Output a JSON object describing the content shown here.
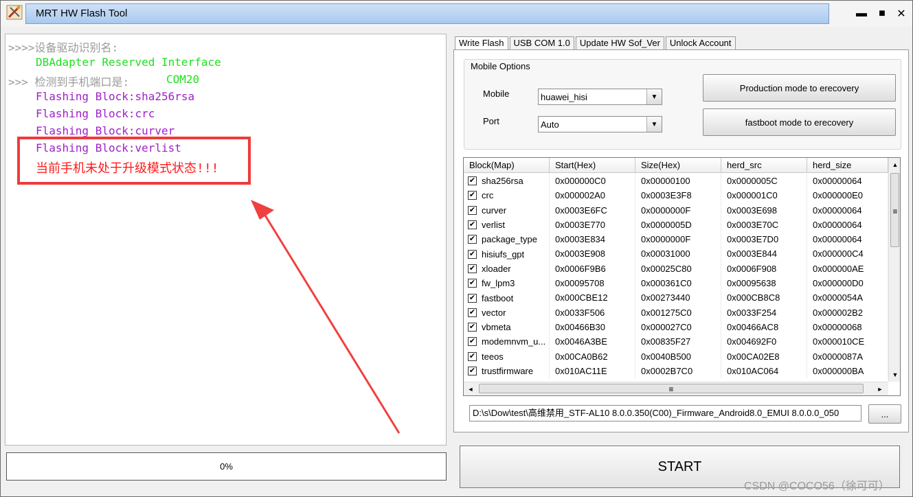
{
  "window": {
    "title": "MRT HW Flash Tool",
    "minimize_label": "▬",
    "maximize_label": "■",
    "close_label": "✕"
  },
  "log": {
    "lines": [
      {
        "text": ">>>>设备驱动识别名:",
        "color": "#9a9a9a"
      },
      {
        "text": "DBAdapter Reserved Interface",
        "color": "#20e020"
      },
      {
        "text": ">>> 检测到手机端口是:",
        "color": "#9a9a9a"
      },
      {
        "text": "COM20",
        "color": "#20e020"
      },
      {
        "text": "Flashing Block:sha256rsa",
        "color": "#a020c8"
      },
      {
        "text": "Flashing Block:crc",
        "color": "#a020c8"
      },
      {
        "text": "Flashing Block:curver",
        "color": "#a020c8"
      },
      {
        "text": "Flashing Block:verlist",
        "color": "#a020c8"
      },
      {
        "text": "当前手机未处于升级模式状态!!!",
        "color": "#ff1a1a"
      }
    ]
  },
  "progress": {
    "label": "0%",
    "value": 0
  },
  "tabs": [
    {
      "label": "Write Flash",
      "active": true
    },
    {
      "label": "USB COM 1.0",
      "active": false
    },
    {
      "label": "Update HW Sof_Ver",
      "active": false
    },
    {
      "label": "Unlock Account",
      "active": false
    }
  ],
  "mobile_options": {
    "title": "Mobile Options",
    "mobile_label": "Mobile",
    "mobile_value": "huawei_hisi",
    "port_label": "Port",
    "port_value": "Auto",
    "production_button": "Production mode to erecovery",
    "fastboot_button": "fastboot mode to erecovery"
  },
  "grid": {
    "columns": [
      "Block(Map)",
      "Start(Hex)",
      "Size(Hex)",
      "herd_src",
      "herd_size"
    ],
    "rows": [
      {
        "checked": true,
        "cells": [
          "sha256rsa",
          "0x000000C0",
          "0x00000100",
          "0x0000005C",
          "0x00000064"
        ]
      },
      {
        "checked": true,
        "cells": [
          "crc",
          "0x000002A0",
          "0x0003E3F8",
          "0x000001C0",
          "0x000000E0"
        ]
      },
      {
        "checked": true,
        "cells": [
          "curver",
          "0x0003E6FC",
          "0x0000000F",
          "0x0003E698",
          "0x00000064"
        ]
      },
      {
        "checked": true,
        "cells": [
          "verlist",
          "0x0003E770",
          "0x0000005D",
          "0x0003E70C",
          "0x00000064"
        ]
      },
      {
        "checked": true,
        "cells": [
          "package_type",
          "0x0003E834",
          "0x0000000F",
          "0x0003E7D0",
          "0x00000064"
        ]
      },
      {
        "checked": true,
        "cells": [
          "hisiufs_gpt",
          "0x0003E908",
          "0x00031000",
          "0x0003E844",
          "0x000000C4"
        ]
      },
      {
        "checked": true,
        "cells": [
          "xloader",
          "0x0006F9B6",
          "0x00025C80",
          "0x0006F908",
          "0x000000AE"
        ]
      },
      {
        "checked": true,
        "cells": [
          "fw_lpm3",
          "0x00095708",
          "0x000361C0",
          "0x00095638",
          "0x000000D0"
        ]
      },
      {
        "checked": true,
        "cells": [
          "fastboot",
          "0x000CBE12",
          "0x00273440",
          "0x000CB8C8",
          "0x0000054A"
        ]
      },
      {
        "checked": true,
        "cells": [
          "vector",
          "0x0033F506",
          "0x001275C0",
          "0x0033F254",
          "0x000002B2"
        ]
      },
      {
        "checked": true,
        "cells": [
          "vbmeta",
          "0x00466B30",
          "0x000027C0",
          "0x00466AC8",
          "0x00000068"
        ]
      },
      {
        "checked": true,
        "cells": [
          "modemnvm_u...",
          "0x0046A3BE",
          "0x00835F27",
          "0x004692F0",
          "0x000010CE"
        ]
      },
      {
        "checked": true,
        "cells": [
          "teeos",
          "0x00CA0B62",
          "0x0040B500",
          "0x00CA02E8",
          "0x0000087A"
        ]
      },
      {
        "checked": true,
        "cells": [
          "trustfirmware",
          "0x010AC11E",
          "0x0002B7C0",
          "0x010AC064",
          "0x000000BA"
        ]
      }
    ],
    "scroll_up": "▲",
    "scroll_down": "▼",
    "scroll_left": "◄",
    "scroll_right": "►",
    "scroll_grip": "≡"
  },
  "firmware_path": "D:\\s\\Dow\\test\\高维禁用_STF-AL10 8.0.0.350(C00)_Firmware_Android8.0_EMUI 8.0.0.0_050",
  "browse_button": "...",
  "start_button": "START",
  "watermark": "CSDN @COCO56（徐可可）",
  "colors": {
    "highlight_box": "#f03a3a",
    "arrow": "#f04040"
  }
}
